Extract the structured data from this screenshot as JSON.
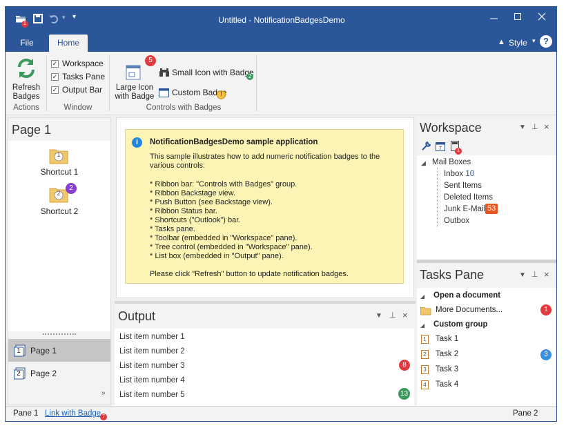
{
  "window": {
    "title": "Untitled - NotificationBadgesDemo",
    "qat_badge": "1"
  },
  "tabs": [
    "File",
    "Home"
  ],
  "style": {
    "label": "Style",
    "help": "?"
  },
  "ribbon": {
    "actions": {
      "refresh_line1": "Refresh",
      "refresh_line2": "Badges",
      "group": "Actions"
    },
    "window_group": {
      "items": [
        "Workspace",
        "Tasks Pane",
        "Output Bar"
      ],
      "group": "Window"
    },
    "controls": {
      "large_line1": "Large Icon",
      "large_line2": "with Badge",
      "large_badge": "5",
      "small": "Small Icon with Badge",
      "small_badge": "2",
      "custom": "Custom Badge",
      "custom_badge": "!",
      "group": "Controls with Badges"
    }
  },
  "shortcuts": {
    "title": "Page 1",
    "items": [
      {
        "label": "Shortcut 1",
        "num": "1"
      },
      {
        "label": "Shortcut 2",
        "num": "2",
        "badge": "2"
      }
    ],
    "pages": [
      {
        "label": "Page 1",
        "num": "1"
      },
      {
        "label": "Page 2",
        "num": "2"
      }
    ]
  },
  "info": {
    "title": "NotificationBadgesDemo sample application",
    "intro": "This sample illustrates how to add numeric notification badges to the various controls:",
    "bullets": [
      "* Ribbon bar: \"Controls with Badges\" group.",
      "* Ribbon Backstage view.",
      "* Push Button (see Backstage view).",
      "* Ribbon Status bar.",
      "* Shortcuts (\"Outlook\") bar.",
      "* Tasks pane.",
      "* Toolbar (embedded in \"Workspace\" pane).",
      "* Tree control (embedded in \"Workspace\" pane).",
      "* List box (embedded in \"Output\" pane)."
    ],
    "footer": "Please click \"Refresh\" button to update notification badges."
  },
  "output": {
    "title": "Output",
    "items": [
      "List item number 1",
      "List item number 2",
      "List item number 3",
      "List item number 4",
      "List item number 5"
    ],
    "badges": {
      "item3": "8",
      "item5": "13"
    }
  },
  "workspace": {
    "title": "Workspace",
    "toolbar_badge": "1",
    "tree": {
      "root": "Mail Boxes",
      "children": [
        {
          "label": "Inbox",
          "count": "10"
        },
        {
          "label": "Sent Items"
        },
        {
          "label": "Deleted Items"
        },
        {
          "label": "Junk E-Mail",
          "count": "53"
        },
        {
          "label": "Outbox"
        }
      ]
    }
  },
  "tasks": {
    "title": "Tasks Pane",
    "group1": "Open a document",
    "more": "More Documents...",
    "more_badge": "1",
    "group2": "Custom group",
    "items": [
      "Task 1",
      "Task 2",
      "Task 3",
      "Task 4"
    ],
    "task2_badge": "3"
  },
  "status": {
    "pane1": "Pane 1",
    "link": "Link with Badge",
    "link_badge": "7",
    "pane2": "Pane 2"
  },
  "colors": {
    "accent": "#2b579a",
    "red": "#e0393e",
    "green": "#3a9a5c",
    "purple": "#8a3fcf",
    "blue": "#3a8fe0",
    "info_bg": "#fbf4b4"
  }
}
